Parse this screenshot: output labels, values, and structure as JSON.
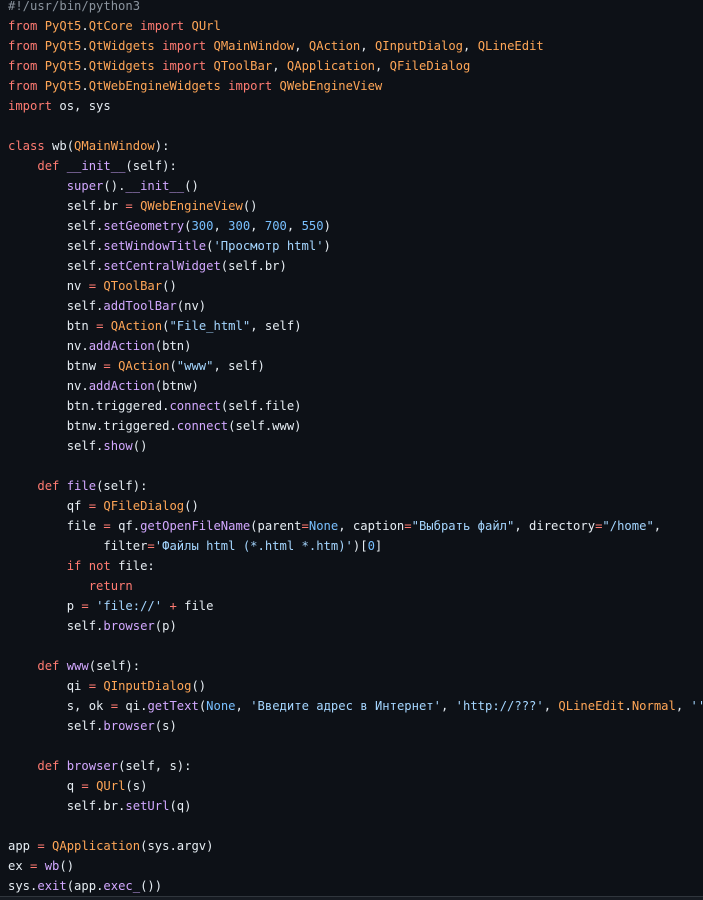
{
  "code": {
    "language": "python",
    "lines": [
      [
        {
          "t": "#!/usr/bin/python3",
          "c": "cm"
        }
      ],
      [
        {
          "t": "from",
          "c": "kw"
        },
        {
          "t": " ",
          "c": "tx"
        },
        {
          "t": "PyQt5",
          "c": "mod"
        },
        {
          "t": ".",
          "c": "tx"
        },
        {
          "t": "QtCore",
          "c": "mod"
        },
        {
          "t": " ",
          "c": "tx"
        },
        {
          "t": "import",
          "c": "kw"
        },
        {
          "t": " ",
          "c": "tx"
        },
        {
          "t": "QUrl",
          "c": "cls"
        }
      ],
      [
        {
          "t": "from",
          "c": "kw"
        },
        {
          "t": " ",
          "c": "tx"
        },
        {
          "t": "PyQt5",
          "c": "mod"
        },
        {
          "t": ".",
          "c": "tx"
        },
        {
          "t": "QtWidgets",
          "c": "mod"
        },
        {
          "t": " ",
          "c": "tx"
        },
        {
          "t": "import",
          "c": "kw"
        },
        {
          "t": " ",
          "c": "tx"
        },
        {
          "t": "QMainWindow",
          "c": "cls"
        },
        {
          "t": ", ",
          "c": "tx"
        },
        {
          "t": "QAction",
          "c": "cls"
        },
        {
          "t": ", ",
          "c": "tx"
        },
        {
          "t": "QInputDialog",
          "c": "cls"
        },
        {
          "t": ", ",
          "c": "tx"
        },
        {
          "t": "QLineEdit",
          "c": "cls"
        }
      ],
      [
        {
          "t": "from",
          "c": "kw"
        },
        {
          "t": " ",
          "c": "tx"
        },
        {
          "t": "PyQt5",
          "c": "mod"
        },
        {
          "t": ".",
          "c": "tx"
        },
        {
          "t": "QtWidgets",
          "c": "mod"
        },
        {
          "t": " ",
          "c": "tx"
        },
        {
          "t": "import",
          "c": "kw"
        },
        {
          "t": " ",
          "c": "tx"
        },
        {
          "t": "QToolBar",
          "c": "cls"
        },
        {
          "t": ", ",
          "c": "tx"
        },
        {
          "t": "QApplication",
          "c": "cls"
        },
        {
          "t": ", ",
          "c": "tx"
        },
        {
          "t": "QFileDialog",
          "c": "cls"
        }
      ],
      [
        {
          "t": "from",
          "c": "kw"
        },
        {
          "t": " ",
          "c": "tx"
        },
        {
          "t": "PyQt5",
          "c": "mod"
        },
        {
          "t": ".",
          "c": "tx"
        },
        {
          "t": "QtWebEngineWidgets",
          "c": "mod"
        },
        {
          "t": " ",
          "c": "tx"
        },
        {
          "t": "import",
          "c": "kw"
        },
        {
          "t": " ",
          "c": "tx"
        },
        {
          "t": "QWebEngineView",
          "c": "cls"
        }
      ],
      [
        {
          "t": "import",
          "c": "kw"
        },
        {
          "t": " os, sys",
          "c": "tx"
        }
      ],
      [],
      [
        {
          "t": "class",
          "c": "kw"
        },
        {
          "t": " wb(",
          "c": "tx"
        },
        {
          "t": "QMainWindow",
          "c": "cls"
        },
        {
          "t": "):",
          "c": "tx"
        }
      ],
      [
        {
          "t": "    ",
          "c": "tx"
        },
        {
          "t": "def",
          "c": "kw"
        },
        {
          "t": " ",
          "c": "tx"
        },
        {
          "t": "__init__",
          "c": "fn"
        },
        {
          "t": "(self):",
          "c": "tx"
        }
      ],
      [
        {
          "t": "        ",
          "c": "tx"
        },
        {
          "t": "super",
          "c": "fn"
        },
        {
          "t": "().",
          "c": "tx"
        },
        {
          "t": "__init__",
          "c": "fn"
        },
        {
          "t": "()",
          "c": "tx"
        }
      ],
      [
        {
          "t": "        self.br ",
          "c": "tx"
        },
        {
          "t": "=",
          "c": "op"
        },
        {
          "t": " ",
          "c": "tx"
        },
        {
          "t": "QWebEngineView",
          "c": "cls"
        },
        {
          "t": "()",
          "c": "tx"
        }
      ],
      [
        {
          "t": "        self.",
          "c": "tx"
        },
        {
          "t": "setGeometry",
          "c": "fn"
        },
        {
          "t": "(",
          "c": "tx"
        },
        {
          "t": "300",
          "c": "num"
        },
        {
          "t": ", ",
          "c": "tx"
        },
        {
          "t": "300",
          "c": "num"
        },
        {
          "t": ", ",
          "c": "tx"
        },
        {
          "t": "700",
          "c": "num"
        },
        {
          "t": ", ",
          "c": "tx"
        },
        {
          "t": "550",
          "c": "num"
        },
        {
          "t": ")",
          "c": "tx"
        }
      ],
      [
        {
          "t": "        self.",
          "c": "tx"
        },
        {
          "t": "setWindowTitle",
          "c": "fn"
        },
        {
          "t": "(",
          "c": "tx"
        },
        {
          "t": "'Просмотр html'",
          "c": "str"
        },
        {
          "t": ")",
          "c": "tx"
        }
      ],
      [
        {
          "t": "        self.",
          "c": "tx"
        },
        {
          "t": "setCentralWidget",
          "c": "fn"
        },
        {
          "t": "(self.br)",
          "c": "tx"
        }
      ],
      [
        {
          "t": "        nv ",
          "c": "tx"
        },
        {
          "t": "=",
          "c": "op"
        },
        {
          "t": " ",
          "c": "tx"
        },
        {
          "t": "QToolBar",
          "c": "cls"
        },
        {
          "t": "()",
          "c": "tx"
        }
      ],
      [
        {
          "t": "        self.",
          "c": "tx"
        },
        {
          "t": "addToolBar",
          "c": "fn"
        },
        {
          "t": "(nv)",
          "c": "tx"
        }
      ],
      [
        {
          "t": "        btn ",
          "c": "tx"
        },
        {
          "t": "=",
          "c": "op"
        },
        {
          "t": " ",
          "c": "tx"
        },
        {
          "t": "QAction",
          "c": "cls"
        },
        {
          "t": "(",
          "c": "tx"
        },
        {
          "t": "\"File_html\"",
          "c": "str"
        },
        {
          "t": ", self)",
          "c": "tx"
        }
      ],
      [
        {
          "t": "        nv.",
          "c": "tx"
        },
        {
          "t": "addAction",
          "c": "fn"
        },
        {
          "t": "(btn)",
          "c": "tx"
        }
      ],
      [
        {
          "t": "        btnw ",
          "c": "tx"
        },
        {
          "t": "=",
          "c": "op"
        },
        {
          "t": " ",
          "c": "tx"
        },
        {
          "t": "QAction",
          "c": "cls"
        },
        {
          "t": "(",
          "c": "tx"
        },
        {
          "t": "\"www\"",
          "c": "str"
        },
        {
          "t": ", self)",
          "c": "tx"
        }
      ],
      [
        {
          "t": "        nv.",
          "c": "tx"
        },
        {
          "t": "addAction",
          "c": "fn"
        },
        {
          "t": "(btnw)",
          "c": "tx"
        }
      ],
      [
        {
          "t": "        btn.triggered.",
          "c": "tx"
        },
        {
          "t": "connect",
          "c": "fn"
        },
        {
          "t": "(self.file)",
          "c": "tx"
        }
      ],
      [
        {
          "t": "        btnw.triggered.",
          "c": "tx"
        },
        {
          "t": "connect",
          "c": "fn"
        },
        {
          "t": "(self.www)",
          "c": "tx"
        }
      ],
      [
        {
          "t": "        self.",
          "c": "tx"
        },
        {
          "t": "show",
          "c": "fn"
        },
        {
          "t": "()",
          "c": "tx"
        }
      ],
      [],
      [
        {
          "t": "    ",
          "c": "tx"
        },
        {
          "t": "def",
          "c": "kw"
        },
        {
          "t": " ",
          "c": "tx"
        },
        {
          "t": "file",
          "c": "fn"
        },
        {
          "t": "(self):",
          "c": "tx"
        }
      ],
      [
        {
          "t": "        qf ",
          "c": "tx"
        },
        {
          "t": "=",
          "c": "op"
        },
        {
          "t": " ",
          "c": "tx"
        },
        {
          "t": "QFileDialog",
          "c": "cls"
        },
        {
          "t": "()",
          "c": "tx"
        }
      ],
      [
        {
          "t": "        file ",
          "c": "tx"
        },
        {
          "t": "=",
          "c": "op"
        },
        {
          "t": " qf.",
          "c": "tx"
        },
        {
          "t": "getOpenFileName",
          "c": "fn"
        },
        {
          "t": "(parent",
          "c": "tx"
        },
        {
          "t": "=",
          "c": "op"
        },
        {
          "t": "None",
          "c": "bi"
        },
        {
          "t": ", caption",
          "c": "tx"
        },
        {
          "t": "=",
          "c": "op"
        },
        {
          "t": "\"Выбрать файл\"",
          "c": "str"
        },
        {
          "t": ", directory",
          "c": "tx"
        },
        {
          "t": "=",
          "c": "op"
        },
        {
          "t": "\"/home\"",
          "c": "str"
        },
        {
          "t": ",",
          "c": "tx"
        }
      ],
      [
        {
          "t": "             filter",
          "c": "tx"
        },
        {
          "t": "=",
          "c": "op"
        },
        {
          "t": "'Файлы html (*.html *.htm)'",
          "c": "str"
        },
        {
          "t": ")[",
          "c": "tx"
        },
        {
          "t": "0",
          "c": "num"
        },
        {
          "t": "]",
          "c": "tx"
        }
      ],
      [
        {
          "t": "        ",
          "c": "tx"
        },
        {
          "t": "if",
          "c": "kw"
        },
        {
          "t": " ",
          "c": "tx"
        },
        {
          "t": "not",
          "c": "kw"
        },
        {
          "t": " file:",
          "c": "tx"
        }
      ],
      [
        {
          "t": "           ",
          "c": "tx"
        },
        {
          "t": "return",
          "c": "kw"
        }
      ],
      [
        {
          "t": "        p ",
          "c": "tx"
        },
        {
          "t": "=",
          "c": "op"
        },
        {
          "t": " ",
          "c": "tx"
        },
        {
          "t": "'file://'",
          "c": "str"
        },
        {
          "t": " ",
          "c": "tx"
        },
        {
          "t": "+",
          "c": "op"
        },
        {
          "t": " file",
          "c": "tx"
        }
      ],
      [
        {
          "t": "        self.",
          "c": "tx"
        },
        {
          "t": "browser",
          "c": "fn"
        },
        {
          "t": "(p)",
          "c": "tx"
        }
      ],
      [],
      [
        {
          "t": "    ",
          "c": "tx"
        },
        {
          "t": "def",
          "c": "kw"
        },
        {
          "t": " ",
          "c": "tx"
        },
        {
          "t": "www",
          "c": "fn"
        },
        {
          "t": "(self):",
          "c": "tx"
        }
      ],
      [
        {
          "t": "        qi ",
          "c": "tx"
        },
        {
          "t": "=",
          "c": "op"
        },
        {
          "t": " ",
          "c": "tx"
        },
        {
          "t": "QInputDialog",
          "c": "cls"
        },
        {
          "t": "()",
          "c": "tx"
        }
      ],
      [
        {
          "t": "        s, ok ",
          "c": "tx"
        },
        {
          "t": "=",
          "c": "op"
        },
        {
          "t": " qi.",
          "c": "tx"
        },
        {
          "t": "getText",
          "c": "fn"
        },
        {
          "t": "(",
          "c": "tx"
        },
        {
          "t": "None",
          "c": "bi"
        },
        {
          "t": ", ",
          "c": "tx"
        },
        {
          "t": "'Введите адрес в Интернет'",
          "c": "str"
        },
        {
          "t": ", ",
          "c": "tx"
        },
        {
          "t": "'http://???'",
          "c": "str"
        },
        {
          "t": ", ",
          "c": "tx"
        },
        {
          "t": "QLineEdit",
          "c": "cls"
        },
        {
          "t": ".",
          "c": "tx"
        },
        {
          "t": "Normal",
          "c": "cls"
        },
        {
          "t": ", ",
          "c": "tx"
        },
        {
          "t": "''",
          "c": "str"
        },
        {
          "t": ")",
          "c": "tx"
        }
      ],
      [
        {
          "t": "        self.",
          "c": "tx"
        },
        {
          "t": "browser",
          "c": "fn"
        },
        {
          "t": "(s)",
          "c": "tx"
        }
      ],
      [],
      [
        {
          "t": "    ",
          "c": "tx"
        },
        {
          "t": "def",
          "c": "kw"
        },
        {
          "t": " ",
          "c": "tx"
        },
        {
          "t": "browser",
          "c": "fn"
        },
        {
          "t": "(self, s):",
          "c": "tx"
        }
      ],
      [
        {
          "t": "        q ",
          "c": "tx"
        },
        {
          "t": "=",
          "c": "op"
        },
        {
          "t": " ",
          "c": "tx"
        },
        {
          "t": "QUrl",
          "c": "cls"
        },
        {
          "t": "(s)",
          "c": "tx"
        }
      ],
      [
        {
          "t": "        self.br.",
          "c": "tx"
        },
        {
          "t": "setUrl",
          "c": "fn"
        },
        {
          "t": "(q)",
          "c": "tx"
        }
      ],
      [],
      [
        {
          "t": "app ",
          "c": "tx"
        },
        {
          "t": "=",
          "c": "op"
        },
        {
          "t": " ",
          "c": "tx"
        },
        {
          "t": "QApplication",
          "c": "cls"
        },
        {
          "t": "(sys.argv)",
          "c": "tx"
        }
      ],
      [
        {
          "t": "ex ",
          "c": "tx"
        },
        {
          "t": "=",
          "c": "op"
        },
        {
          "t": " ",
          "c": "tx"
        },
        {
          "t": "wb",
          "c": "fn"
        },
        {
          "t": "()",
          "c": "tx"
        }
      ],
      [
        {
          "t": "sys.",
          "c": "tx"
        },
        {
          "t": "exit",
          "c": "fn"
        },
        {
          "t": "(app.",
          "c": "tx"
        },
        {
          "t": "exec_",
          "c": "fn"
        },
        {
          "t": "())",
          "c": "tx"
        }
      ]
    ]
  }
}
